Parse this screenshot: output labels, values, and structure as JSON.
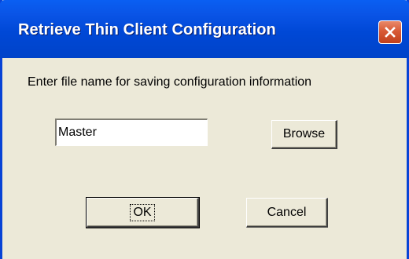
{
  "window": {
    "title": "Retrieve Thin Client Configuration",
    "close_icon": "close-x-icon"
  },
  "dialog": {
    "prompt": "Enter file name for saving configuration information",
    "filename_value": "Master",
    "browse_label": "Browse",
    "ok_label": "OK",
    "cancel_label": "Cancel"
  },
  "colors": {
    "titlebar": "#0048d6",
    "dialog_background": "#ece9d8",
    "close_button": "#d85a36"
  }
}
